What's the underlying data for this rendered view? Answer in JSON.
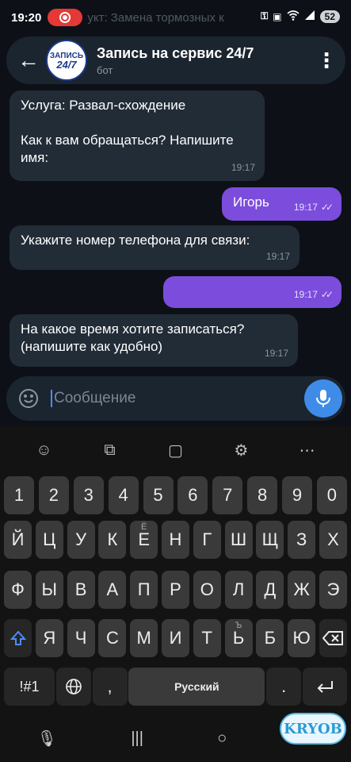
{
  "status": {
    "time": "19:20",
    "ghost_text": "укт: Замена тормозных к",
    "battery": "52"
  },
  "header": {
    "title": "Запись на сервис 24/7",
    "subtitle": "бот",
    "avatar_top": "ЗАПИСЬ",
    "avatar_big": "24/7"
  },
  "messages": [
    {
      "text_line1": "Услуга: Развал-схождение",
      "text_line2": "Как к вам обращаться? Напишите",
      "text_line3": "имя:",
      "time": "19:17"
    },
    {
      "text": "Игорь",
      "time": "19:17"
    },
    {
      "text": "Укажите номер телефона для связи:",
      "time": "19:17"
    },
    {
      "text": "",
      "time": "19:17"
    },
    {
      "text_line1": "На какое время хотите записаться?",
      "text_line2": "(напишите как удобно)",
      "time": "19:17"
    }
  ],
  "input": {
    "placeholder": "Сообщение"
  },
  "keyboard": {
    "numbers": [
      "1",
      "2",
      "3",
      "4",
      "5",
      "6",
      "7",
      "8",
      "9",
      "0"
    ],
    "row1": [
      "Й",
      "Ц",
      "У",
      "К",
      "Е",
      "Н",
      "Г",
      "Ш",
      "Щ",
      "З",
      "Х"
    ],
    "row1_hint_e": "Ё",
    "row2": [
      "Ф",
      "Ы",
      "В",
      "А",
      "П",
      "Р",
      "О",
      "Л",
      "Д",
      "Ж",
      "Э"
    ],
    "row3": [
      "Я",
      "Ч",
      "С",
      "М",
      "И",
      "Т",
      "Ь",
      "Б",
      "Ю"
    ],
    "row3_hint_soft": "Ъ",
    "sym": "!#1",
    "comma": ",",
    "space": "Русский",
    "period": "."
  },
  "watermark": "KRYOB"
}
